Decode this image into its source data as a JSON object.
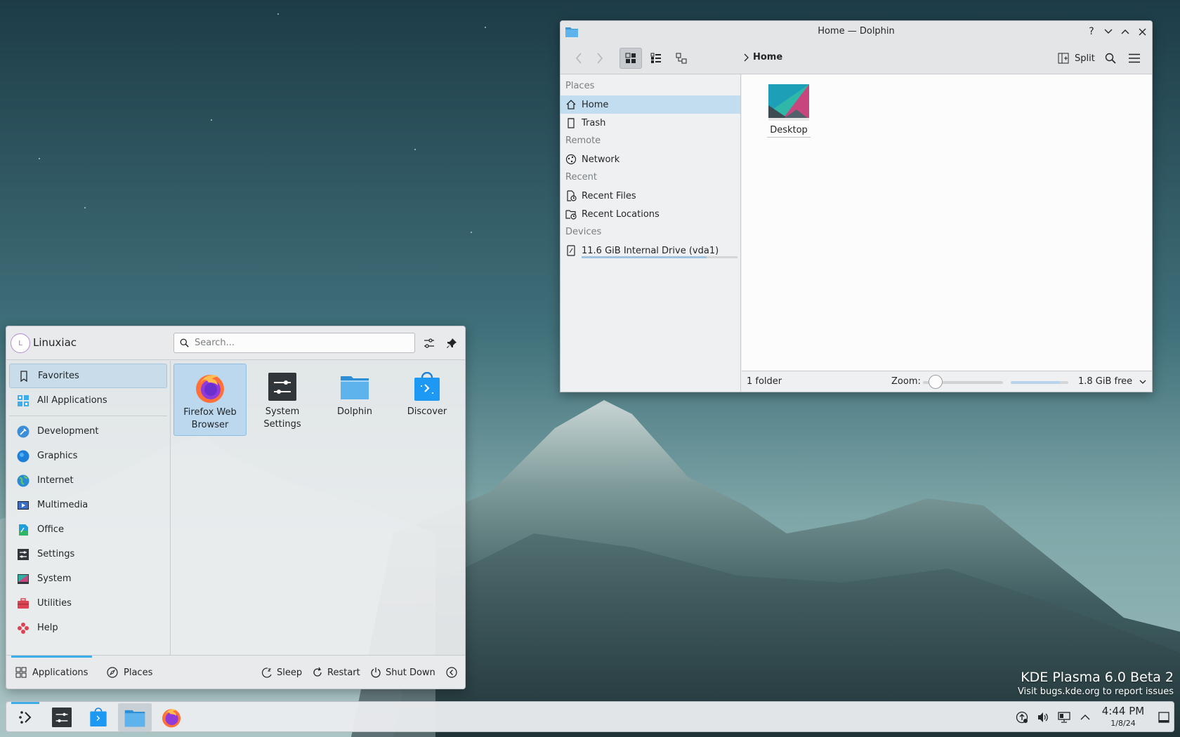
{
  "desktop": {
    "watermark_title": "KDE Plasma 6.0 Beta 2",
    "watermark_sub": "Visit bugs.kde.org to report issues"
  },
  "dolphin": {
    "title": "Home — Dolphin",
    "breadcrumb": "Home",
    "split_label": "Split",
    "places": {
      "sections": [
        {
          "label": "Places",
          "items": [
            {
              "label": "Home",
              "icon": "home-icon",
              "selected": true
            },
            {
              "label": "Trash",
              "icon": "trash-icon",
              "selected": false
            }
          ]
        },
        {
          "label": "Remote",
          "items": [
            {
              "label": "Network",
              "icon": "network-icon",
              "selected": false
            }
          ]
        },
        {
          "label": "Recent",
          "items": [
            {
              "label": "Recent Files",
              "icon": "recent-files-icon",
              "selected": false
            },
            {
              "label": "Recent Locations",
              "icon": "recent-locations-icon",
              "selected": false
            }
          ]
        },
        {
          "label": "Devices",
          "items": [
            {
              "label": "11.6 GiB Internal Drive (vda1)",
              "icon": "drive-icon",
              "selected": false,
              "usage": 0.8
            }
          ]
        }
      ]
    },
    "files": [
      {
        "label": "Desktop",
        "icon": "folder-desktop-icon"
      }
    ],
    "status": {
      "text": "1 folder",
      "zoom_label": "Zoom:",
      "zoom_level": 0.1,
      "free_label": "1.8 GiB free",
      "used_fraction": 0.85
    }
  },
  "kickoff": {
    "username": "Linuxiac",
    "avatar_letter": "L",
    "search_placeholder": "Search...",
    "categories": [
      {
        "label": "Favorites",
        "icon": "bookmark-icon",
        "selected": true
      },
      {
        "label": "All Applications",
        "icon": "grid-icon",
        "selected": false
      },
      {
        "label": "Development",
        "icon": "development-icon",
        "selected": false,
        "sep_before": true
      },
      {
        "label": "Graphics",
        "icon": "graphics-icon",
        "selected": false
      },
      {
        "label": "Internet",
        "icon": "internet-icon",
        "selected": false
      },
      {
        "label": "Multimedia",
        "icon": "multimedia-icon",
        "selected": false
      },
      {
        "label": "Office",
        "icon": "office-icon",
        "selected": false
      },
      {
        "label": "Settings",
        "icon": "settings-icon",
        "selected": false
      },
      {
        "label": "System",
        "icon": "system-icon",
        "selected": false
      },
      {
        "label": "Utilities",
        "icon": "utilities-icon",
        "selected": false
      },
      {
        "label": "Help",
        "icon": "help-icon",
        "selected": false
      }
    ],
    "favorites": [
      {
        "label": "Firefox Web Browser",
        "icon": "firefox-icon",
        "selected": true
      },
      {
        "label": "System Settings",
        "icon": "system-settings-icon",
        "selected": false
      },
      {
        "label": "Dolphin",
        "icon": "dolphin-icon",
        "selected": false
      },
      {
        "label": "Discover",
        "icon": "discover-icon",
        "selected": false
      }
    ],
    "footer": {
      "applications": "Applications",
      "places": "Places",
      "sleep": "Sleep",
      "restart": "Restart",
      "shutdown": "Shut Down"
    }
  },
  "taskbar": {
    "time": "4:44 PM",
    "date": "1/8/24",
    "tasks": [
      "application-launcher-icon",
      "system-settings-icon",
      "discover-icon",
      "dolphin-icon",
      "firefox-icon"
    ],
    "tray": [
      "updates-icon",
      "volume-icon",
      "network-wired-icon",
      "chevron-up-icon"
    ]
  }
}
